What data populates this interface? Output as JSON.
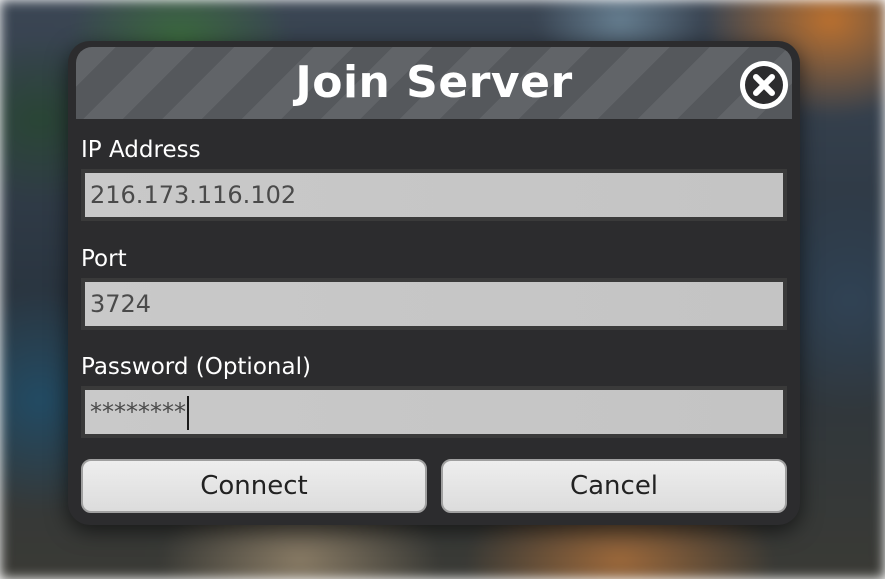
{
  "dialog": {
    "title": "Join Server",
    "close_icon": "close-icon"
  },
  "fields": {
    "ip": {
      "label": "IP Address",
      "value": "216.173.116.102"
    },
    "port": {
      "label": "Port",
      "value": "3724"
    },
    "password": {
      "label": "Password (Optional)",
      "value": "********"
    }
  },
  "buttons": {
    "connect": "Connect",
    "cancel": "Cancel"
  },
  "colors": {
    "dialog_bg": "#2c2c2e",
    "title_bar": "#55585c",
    "input_bg": "#c6c6c6",
    "button_bg": "#e6e6e6"
  }
}
